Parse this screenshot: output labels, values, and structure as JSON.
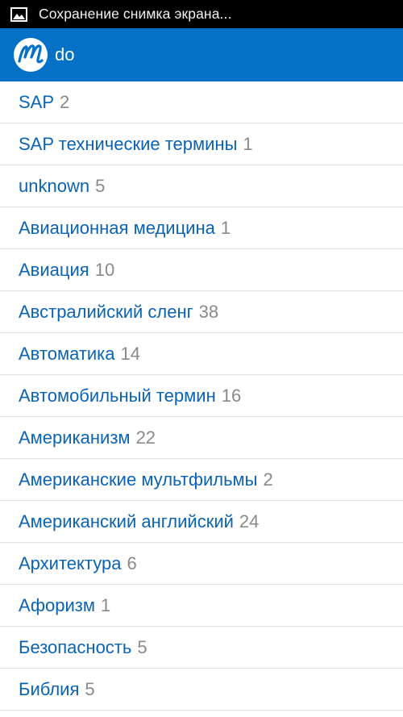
{
  "status_bar": {
    "notification_text": "Сохранение снимка экрана...",
    "icon": "image-icon"
  },
  "action_bar": {
    "title": "do",
    "logo": "multitran-logo"
  },
  "list": {
    "items": [
      {
        "label": "SAP",
        "count": "2"
      },
      {
        "label": "SAP технические термины",
        "count": "1"
      },
      {
        "label": "unknown",
        "count": "5"
      },
      {
        "label": "Авиационная медицина",
        "count": "1"
      },
      {
        "label": "Авиация",
        "count": "10"
      },
      {
        "label": "Австралийский сленг",
        "count": "38"
      },
      {
        "label": "Автоматика",
        "count": "14"
      },
      {
        "label": "Автомобильный термин",
        "count": "16"
      },
      {
        "label": "Американизм",
        "count": "22"
      },
      {
        "label": "Американские мультфильмы",
        "count": "2"
      },
      {
        "label": "Американский английский",
        "count": "24"
      },
      {
        "label": "Архитектура",
        "count": "6"
      },
      {
        "label": "Афоризм",
        "count": "1"
      },
      {
        "label": "Безопасность",
        "count": "5"
      },
      {
        "label": "Библия",
        "count": "5"
      }
    ]
  },
  "colors": {
    "action_bar": "#0571c6",
    "link_text": "#0a63b3",
    "count_text": "#8a8a8a",
    "divider": "#e0e0e0"
  }
}
